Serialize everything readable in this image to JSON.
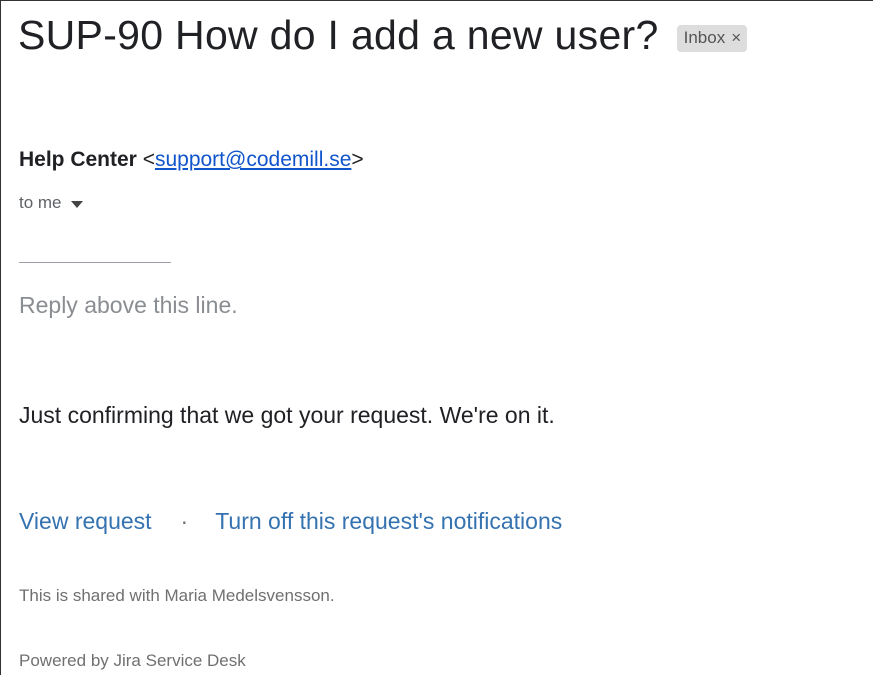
{
  "email": {
    "subject": "SUP-90 How do I add a new user?",
    "label": {
      "text": "Inbox",
      "close": "×"
    },
    "sender": {
      "name": "Help Center",
      "open_bracket": " <",
      "email": "support@codemill.se",
      "close_bracket": ">"
    },
    "recipient": "to me",
    "reply_hint": "Reply above this line.",
    "body_text": "Just confirming that we got your request. We're on it.",
    "links": {
      "view_request": "View request",
      "separator": "·",
      "turn_off": "Turn off this request's notifications"
    },
    "shared_text": "This is shared with Maria Medelsvensson.",
    "powered_by": "Powered by Jira Service Desk"
  },
  "colors": {
    "link": "#3572b0",
    "email_link": "#1155cc",
    "muted_text": "#707070",
    "label_chip_bg": "#dddddd"
  },
  "icons": {
    "recipient_dropdown": "caret-down-icon",
    "label_remove": "close-icon"
  }
}
